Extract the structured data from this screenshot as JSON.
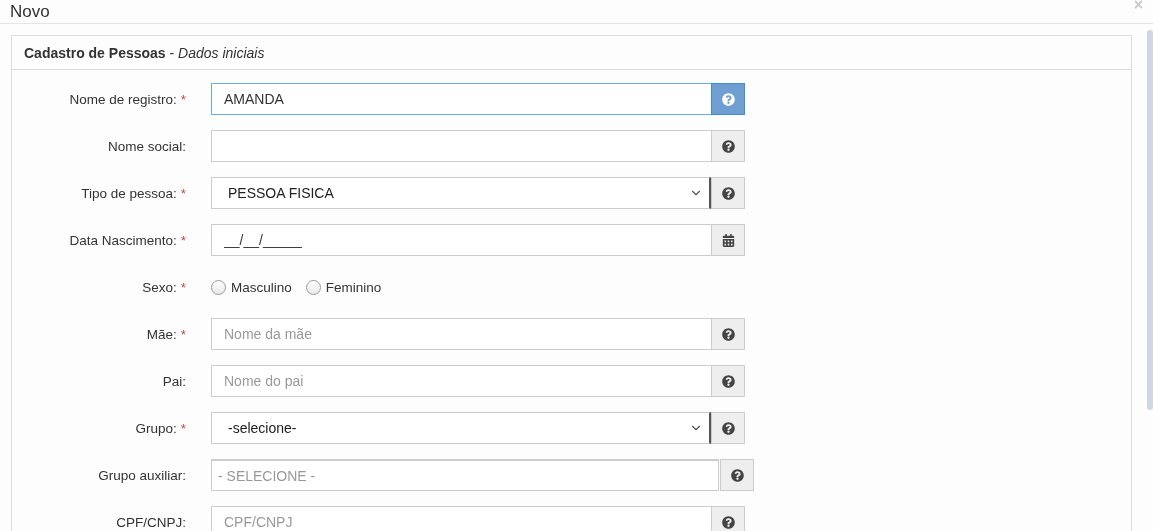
{
  "window": {
    "title": "Novo",
    "close": "×"
  },
  "panel": {
    "title": "**Cadastro de Pessoas** - *Dados iniciais*"
  },
  "fields": [
    {
      "kind": "text",
      "label": "Nome de registro:",
      "required_mark": "*",
      "value": "AMANDA",
      "focused": true
    },
    {
      "kind": "text",
      "label": "Nome social:",
      "focused": false
    },
    {
      "kind": "select",
      "label": "Tipo de pessoa:",
      "required_mark": "*",
      "value": "PESSOA FISICA",
      "focused": false
    },
    {
      "kind": "date",
      "label": "Data Nascimento:",
      "required_mark": "*",
      "value": "__/__/_____",
      "focused": false
    },
    {
      "kind": "radio",
      "label": "Sexo:",
      "required_mark": "*",
      "options": [
        {
          "label": "Masculino",
          "selected": false
        },
        {
          "label": "Feminino",
          "selected": false
        }
      ]
    },
    {
      "kind": "text",
      "label": "Mãe:",
      "required_mark": "*",
      "placeholder": "Nome da mãe",
      "focused": false
    },
    {
      "kind": "text",
      "label": "Pai:",
      "placeholder": "Nome do pai",
      "focused": false
    },
    {
      "kind": "select",
      "label": "Grupo:",
      "required_mark": "*",
      "value": "-selecione-",
      "focused": false
    },
    {
      "kind": "multiselect",
      "label": "Grupo auxiliar:",
      "placeholder": "- SELECIONE -",
      "focused": false
    },
    {
      "kind": "text",
      "label": "CPF/CNPJ:",
      "placeholder": "CPF/CNPJ",
      "focused": false
    }
  ]
}
